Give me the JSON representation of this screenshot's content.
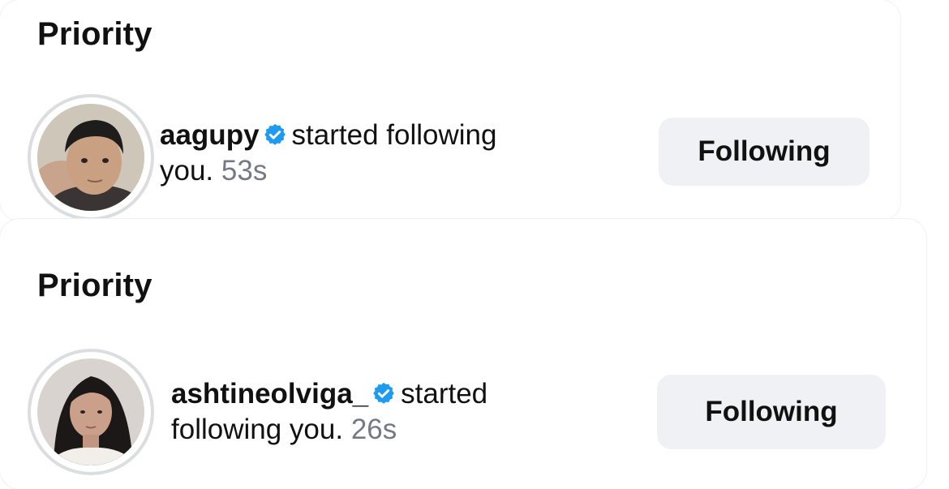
{
  "notifications": [
    {
      "section_title": "Priority",
      "username": "aagupy",
      "verified_icon": "verified-badge-icon",
      "action_text": "started following",
      "continuation": "you.",
      "timestamp": "53s",
      "button_label": "Following"
    },
    {
      "section_title": "Priority",
      "username": "ashtineolviga_",
      "verified_icon": "verified-badge-icon",
      "action_text": "started",
      "continuation": "following you.",
      "timestamp": "26s",
      "button_label": "Following"
    }
  ],
  "colors": {
    "verified_blue": "#1d9bf0",
    "timestamp_gray": "#737a85",
    "button_bg": "#eff1f4",
    "avatar_ring": "#dcdde1"
  }
}
